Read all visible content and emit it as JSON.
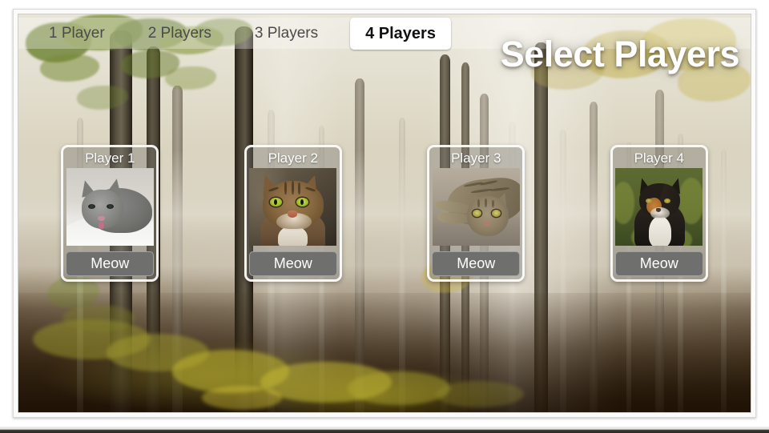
{
  "window": {
    "title": "Select Players"
  },
  "tabs": {
    "items": [
      {
        "label": "1 Player",
        "active": false,
        "name": "tab-1-player"
      },
      {
        "label": "2 Players",
        "active": false,
        "name": "tab-2-players"
      },
      {
        "label": "3 Players",
        "active": false,
        "name": "tab-3-players"
      },
      {
        "label": "4 Players",
        "active": true,
        "name": "tab-4-players"
      }
    ]
  },
  "header": {
    "title": "Select Players",
    "title_color": "#ffffff"
  },
  "players": [
    {
      "title": "Player 1",
      "button_label": "Meow",
      "photo_alt": "grey kitten lying on a white blanket"
    },
    {
      "title": "Player 2",
      "button_label": "Meow",
      "photo_alt": "brown tabby cat facing forward with green eyes"
    },
    {
      "title": "Player 3",
      "button_label": "Meow",
      "photo_alt": "tabby cat lying on pavement"
    },
    {
      "title": "Player 4",
      "button_label": "Meow",
      "photo_alt": "calico cat sitting in green grass"
    }
  ],
  "theme": {
    "active_tab_bg": "#ffffff",
    "active_tab_text": "#111111",
    "inactive_tab_text": "#4a4a4a",
    "tabbar_bg": "rgba(255,255,255,0.30)",
    "card_border": "#ffffff",
    "meow_button_bg": "#6f6f6d",
    "meow_button_text": "#ffffff",
    "background_scene": "misty autumn beech forest"
  }
}
